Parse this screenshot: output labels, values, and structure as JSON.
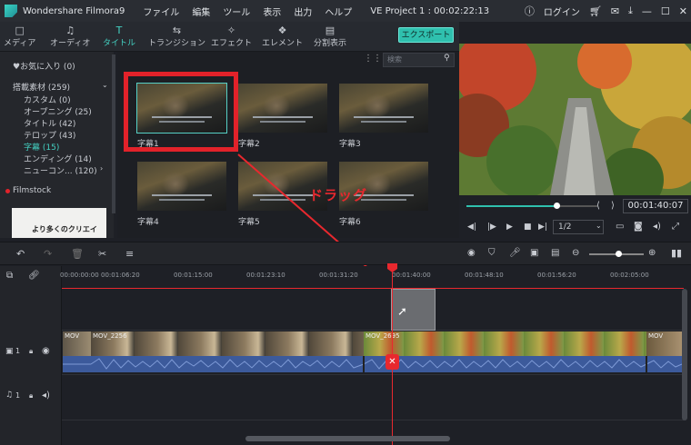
{
  "window": {
    "app_title": "Wondershare Filmora9",
    "menus": [
      "ファイル",
      "編集",
      "ツール",
      "表示",
      "出力",
      "ヘルプ"
    ],
    "project": "VE Project 1 : 00:02:22:13",
    "login": "ログイン"
  },
  "tabs": [
    {
      "label": "メディア",
      "icon": "□"
    },
    {
      "label": "オーディオ",
      "icon": "♫"
    },
    {
      "label": "タイトル",
      "icon": "T"
    },
    {
      "label": "トランジション",
      "icon": "⇆"
    },
    {
      "label": "エフェクト",
      "icon": "✧"
    },
    {
      "label": "エレメント",
      "icon": "❖"
    },
    {
      "label": "分割表示",
      "icon": "▤"
    }
  ],
  "export_label": "エクスポート",
  "search_placeholder": "検索",
  "sidebar": {
    "favorites": "♥お気に入り (0)",
    "group": "搭載素材 (259)",
    "items": [
      "カスタム (0)",
      "オープニング (25)",
      "タイトル (42)",
      "テロップ (43)",
      "字幕 (15)",
      "エンディング (14)",
      "ニューコン... (120)"
    ],
    "filmstock": "Filmstock",
    "banner": "より多くのクリエイ"
  },
  "thumbs": [
    "字幕1",
    "字幕2",
    "字幕3",
    "字幕4",
    "字幕5",
    "字幕6"
  ],
  "annotation": "ドラッグ",
  "preview": {
    "timecode": "00:01:40:07",
    "ratio": "1/2"
  },
  "ruler": [
    "00:00:00:00",
    "00:01:06:20",
    "00:01:15:00",
    "00:01:23:10",
    "00:01:31:20",
    "00:01:40:00",
    "00:01:48:10",
    "00:01:56:20",
    "00:02:05:00"
  ],
  "tracks": {
    "video_index": "1",
    "audio_index": "1",
    "clip1": "MOV_2256",
    "clip2": "MOV_2695",
    "clip0": "MOV",
    "clip3": "MOV"
  },
  "colors": {
    "accent": "#2fc0ae",
    "red": "#e2222a"
  }
}
